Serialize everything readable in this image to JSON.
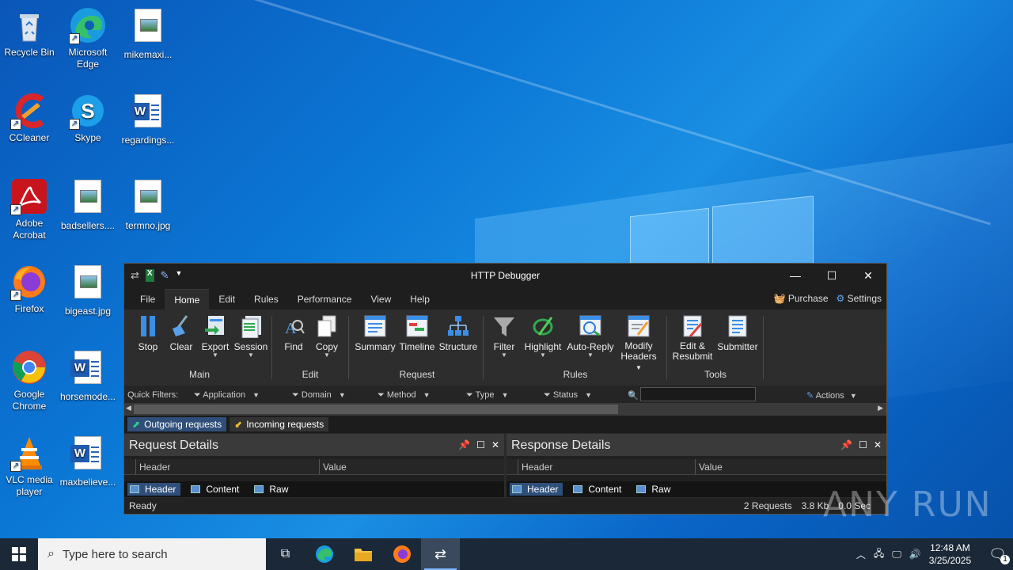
{
  "desktop": {
    "icons": [
      {
        "label": "Recycle Bin",
        "icon": "recycle-bin-icon"
      },
      {
        "label": "Microsoft Edge",
        "icon": "edge-icon"
      },
      {
        "label": "mikemaxi...",
        "icon": "image-file-icon"
      },
      {
        "label": "CCleaner",
        "icon": "ccleaner-icon"
      },
      {
        "label": "Skype",
        "icon": "skype-icon"
      },
      {
        "label": "regardings...",
        "icon": "word-doc-icon"
      },
      {
        "label": "Adobe Acrobat",
        "icon": "acrobat-icon"
      },
      {
        "label": "badsellers....",
        "icon": "image-file-icon"
      },
      {
        "label": "termno.jpg",
        "icon": "image-file-icon"
      },
      {
        "label": "Firefox",
        "icon": "firefox-icon"
      },
      {
        "label": "bigeast.jpg",
        "icon": "image-file-icon"
      },
      {
        "label": "Google Chrome",
        "icon": "chrome-icon"
      },
      {
        "label": "horsemode...",
        "icon": "word-doc-icon"
      },
      {
        "label": "VLC media player",
        "icon": "vlc-icon"
      },
      {
        "label": "maxbelieve...",
        "icon": "word-doc-icon"
      }
    ]
  },
  "app": {
    "title": "HTTP Debugger",
    "menu": [
      "File",
      "Home",
      "Edit",
      "Rules",
      "Performance",
      "View",
      "Help"
    ],
    "active_menu": "Home",
    "purchase": "Purchase",
    "settings": "Settings",
    "ribbon": {
      "stop": "Stop",
      "clear": "Clear",
      "export": "Export",
      "session": "Session",
      "main": "Main",
      "find": "Find",
      "copy": "Copy",
      "edit": "Edit",
      "summary": "Summary",
      "timeline": "Timeline",
      "structure": "Structure",
      "request": "Request",
      "filter": "Filter",
      "highlight": "Highlight",
      "auto_reply": "Auto-Reply",
      "modify_headers": "Modify Headers",
      "rules": "Rules",
      "edit_resubmit": "Edit & Resubmit",
      "submitter": "Submitter",
      "tools": "Tools"
    },
    "filters": {
      "quick": "Quick Filters:",
      "application": "Application",
      "domain": "Domain",
      "method": "Method",
      "type": "Type",
      "status": "Status",
      "actions": "Actions"
    },
    "tabs": {
      "outgoing": "Outgoing requests",
      "incoming": "Incoming requests"
    },
    "request_pane": {
      "title": "Request Details",
      "col_header": "Header",
      "col_value": "Value"
    },
    "response_pane": {
      "title": "Response Details",
      "col_header": "Header",
      "col_value": "Value"
    },
    "bottom_tabs": {
      "header": "Header",
      "content": "Content",
      "raw": "Raw"
    },
    "status": {
      "ready": "Ready",
      "requests": "2 Requests",
      "size": "3.8 Kb",
      "time": "0.0 Sec"
    }
  },
  "taskbar": {
    "search_placeholder": "Type here to search",
    "time": "12:48 AM",
    "date": "3/25/2025",
    "notification_count": "1"
  },
  "watermark": "ANY RUN"
}
